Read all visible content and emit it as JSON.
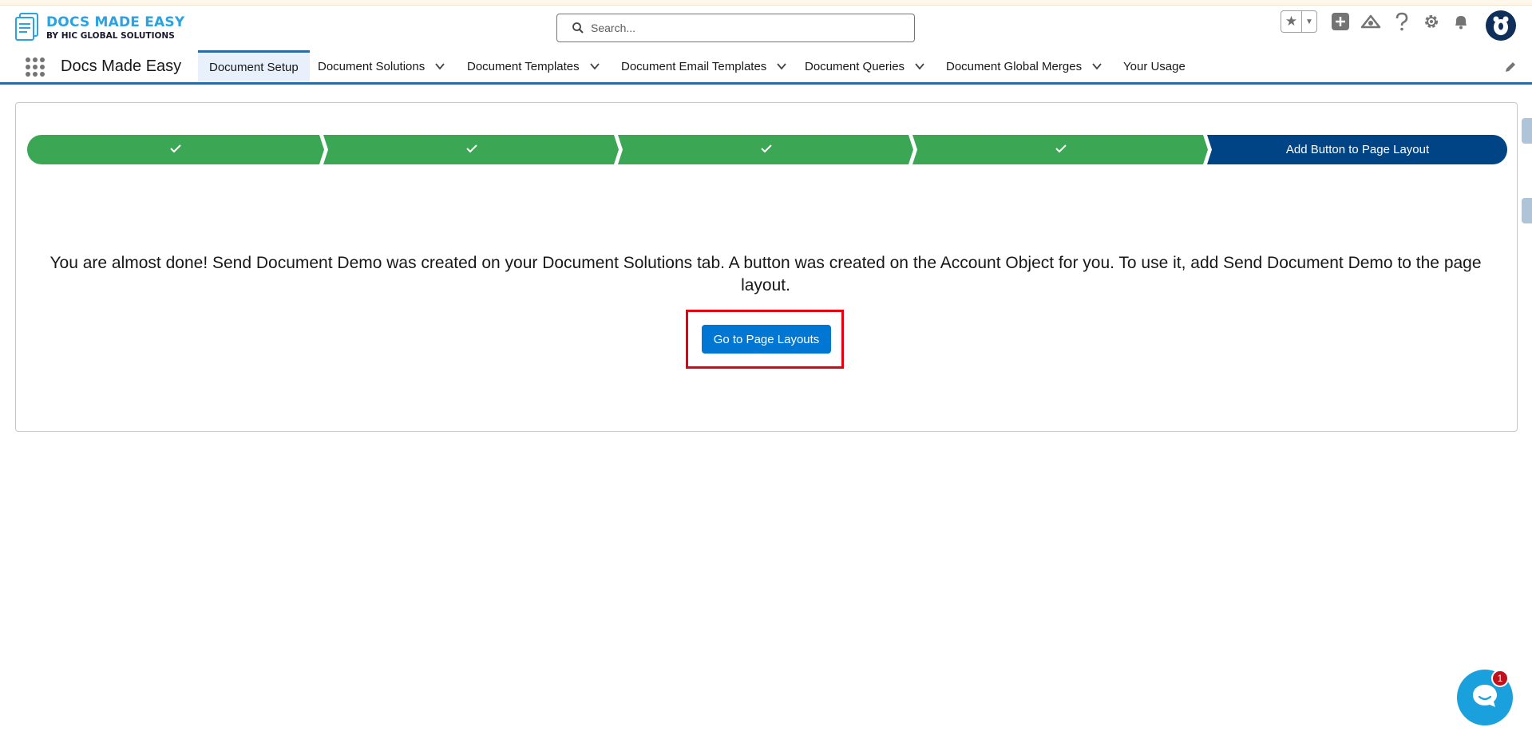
{
  "brand": {
    "logo_title": "DOCS MADE EASY",
    "logo_subtitle": "BY HIC GLOBAL SOLUTIONS",
    "accent": "#29a3e2"
  },
  "header": {
    "search_placeholder": "Search...",
    "icons": [
      "favorites-star-icon",
      "favorites-menu-icon",
      "global-create-icon",
      "trailhead-icon",
      "help-icon",
      "setup-gear-icon",
      "notifications-bell-icon",
      "user-avatar"
    ]
  },
  "nav": {
    "app_name": "Docs Made Easy",
    "tabs": [
      {
        "label": "Document Setup",
        "active": true,
        "has_menu": false
      },
      {
        "label": "Document Solutions",
        "active": false,
        "has_menu": true
      },
      {
        "label": "Document Templates",
        "active": false,
        "has_menu": true
      },
      {
        "label": "Document Email Templates",
        "active": false,
        "has_menu": true
      },
      {
        "label": "Document Queries",
        "active": false,
        "has_menu": true
      },
      {
        "label": "Document Global Merges",
        "active": false,
        "has_menu": true
      },
      {
        "label": "Your Usage",
        "active": false,
        "has_menu": false
      }
    ]
  },
  "path": {
    "steps": [
      {
        "status": "complete",
        "label": ""
      },
      {
        "status": "complete",
        "label": ""
      },
      {
        "status": "complete",
        "label": ""
      },
      {
        "status": "complete",
        "label": ""
      },
      {
        "status": "current",
        "label": "Add Button to Page Layout"
      }
    ],
    "complete_color": "#3ba755",
    "current_color": "#014486"
  },
  "main": {
    "message": "You are almost done! Send Document Demo was created on your Document Solutions tab. A button was created on the Account Object for you. To use it, add Send Document Demo to the page layout.",
    "cta_label": "Go to Page Layouts",
    "cta_color": "#0176d3",
    "highlight_color": "#e3000f"
  },
  "chat": {
    "badge_count": "1"
  }
}
